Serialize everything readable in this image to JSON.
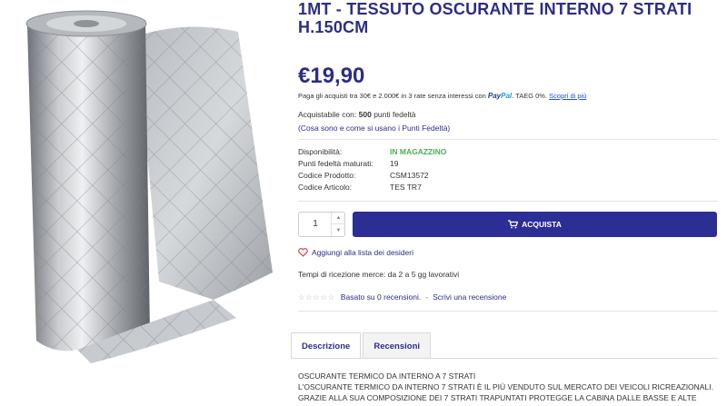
{
  "product": {
    "title_line1": "1MT - TESSUTO OSCURANTE INTERNO 7 STRATI",
    "title_line2": "H.150CM",
    "price": "€19,90"
  },
  "paypal": {
    "text": "Paga gli acquisti tra 30€ e 2.000€ in 3 rate senza interessi con",
    "brand_pay": "Pay",
    "brand_pal": "Pal",
    "taeg": ". TAEG 0%.",
    "link": "Scopri di più"
  },
  "points": {
    "prefix": "Acquistabile con:",
    "amount": "500",
    "suffix": "punti fedeltà",
    "info_link": "(Cosa sono e come si usano i Punti Fedeltà)"
  },
  "specs": [
    {
      "label": "Disponibilità:",
      "value": "IN MAGAZZINO"
    },
    {
      "label": "Punti fedeltà maturati:",
      "value": "19"
    },
    {
      "label": "Codice Prodotto:",
      "value": "CSM13572"
    },
    {
      "label": "Codice Articolo:",
      "value": "TES TR7"
    }
  ],
  "cart": {
    "quantity": "1",
    "buy_label": "ACQUISTA"
  },
  "wishlist_label": "Aggiungi alla lista dei desideri",
  "delivery_text": "Tempi di ricezione merce: da 2 a 5 gg lavorativi",
  "reviews": {
    "stars": "☆☆☆☆☆",
    "count_text": "Basato su 0 recensioni.",
    "separator": "-",
    "write_link": "Scrivi una recensione"
  },
  "tabs": [
    {
      "label": "Descrizione"
    },
    {
      "label": "Recensioni"
    }
  ],
  "description": {
    "line1": "OSCURANTE TERMICO DA INTERNO A 7 STRATI",
    "line2": "L'OSCURANTE TERMICO DA INTERNO 7 STRATI È IL PIÙ VENDUTO SUL MERCATO DEI VEICOLI RICREAZIONALI.",
    "line3": "GRAZIE ALLA SUA COMPOSIZIONE DEI 7 STRATI TRAPUNTATI PROTEGGE LA CABINA DALLE BASSE E ALTE"
  },
  "colors": {
    "brand": "#2c2e84",
    "button": "#2c2e96",
    "stock_green": "#4caf50"
  }
}
